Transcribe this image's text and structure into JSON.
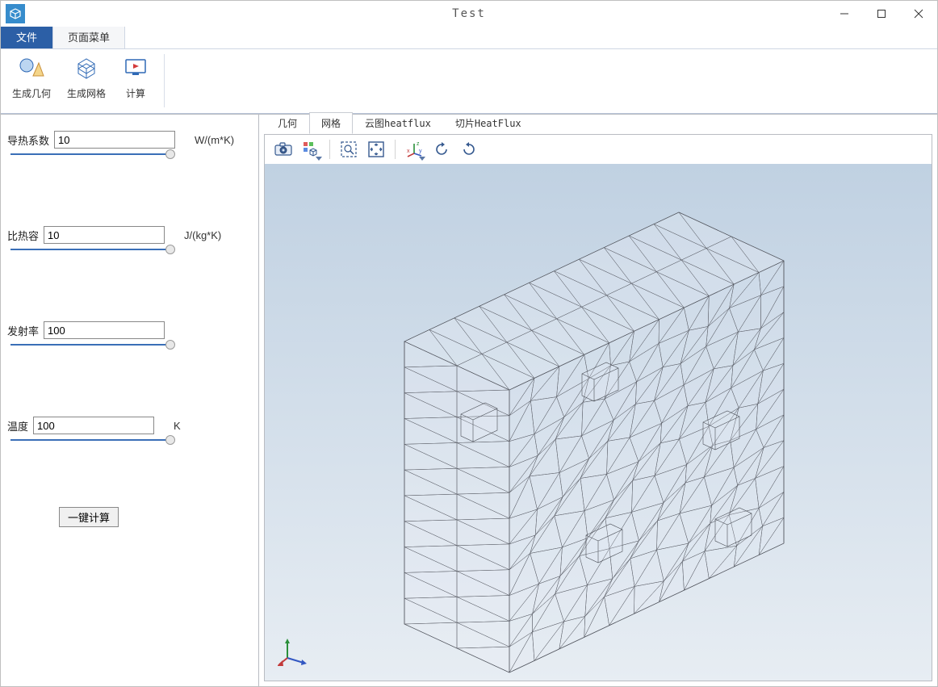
{
  "window": {
    "title": "Test"
  },
  "menutabs": {
    "file": "文件",
    "page_menu": "页面菜单"
  },
  "ribbon": {
    "gen_geometry": "生成几何",
    "gen_mesh": "生成网格",
    "compute": "计算"
  },
  "params": {
    "thermal_conductivity": {
      "label": "导热系数",
      "value": "10",
      "unit": "W/(m*K)"
    },
    "specific_heat": {
      "label": "比热容",
      "value": "10",
      "unit": "J/(kg*K)"
    },
    "emissivity": {
      "label": "发射率",
      "value": "100",
      "unit": ""
    },
    "temperature": {
      "label": "温度",
      "value": "100",
      "unit": "K"
    }
  },
  "buttons": {
    "one_click_compute": "一键计算"
  },
  "viewtabs": {
    "geometry": "几何",
    "mesh": "网格",
    "cloud_heatflux": "云图heatflux",
    "slice_heatflux": "切片HeatFlux"
  },
  "toolbar_icons": {
    "snapshot": "camera-icon",
    "transparency": "cube-toggle-icon",
    "zoom_box": "zoom-box-icon",
    "zoom_extents": "zoom-extents-icon",
    "default_view": "axes-default-icon",
    "rotate_ccw": "rotate-ccw-icon",
    "rotate_cw": "rotate-cw-icon"
  }
}
